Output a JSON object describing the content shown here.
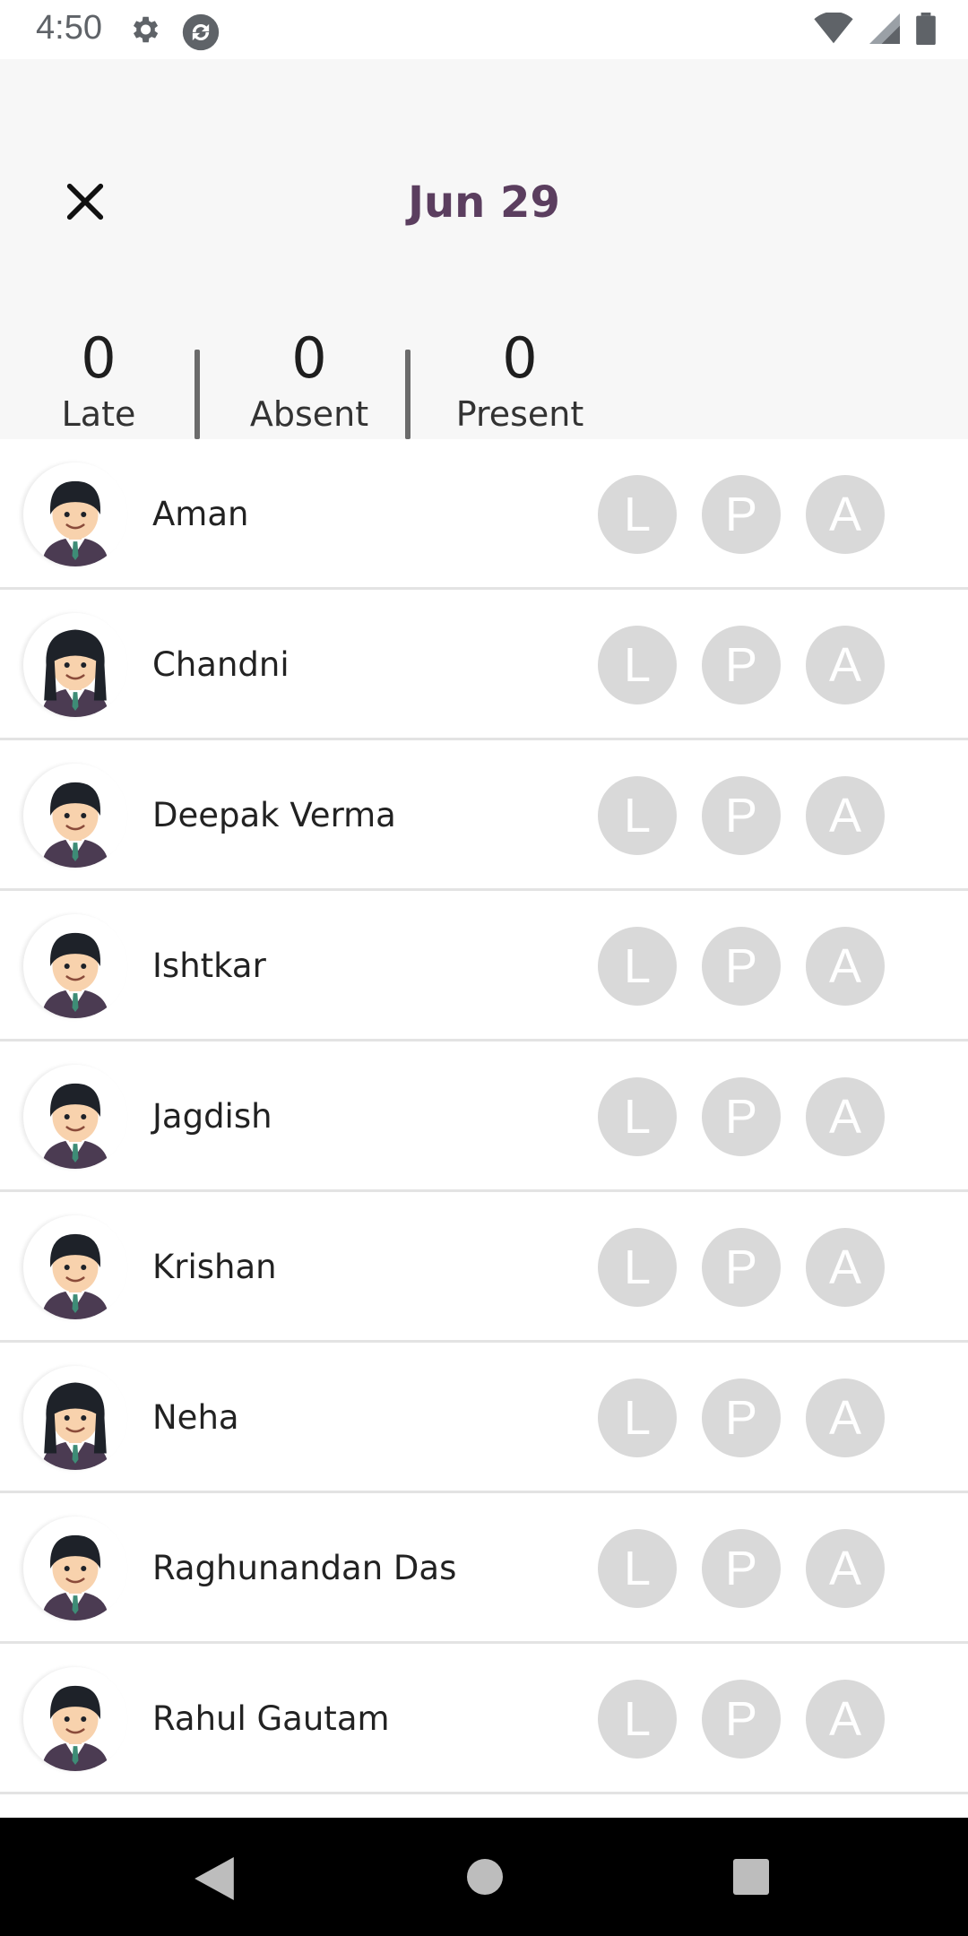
{
  "status_bar": {
    "time": "4:50",
    "left_icons": [
      "gear-icon",
      "sync-icon"
    ],
    "right_icons": [
      "wifi-icon",
      "signal-icon",
      "battery-icon"
    ]
  },
  "header": {
    "close_icon": "close-icon",
    "date": "Jun 29",
    "title_color": "#5b3e5f",
    "stats": [
      {
        "value": "0",
        "label": "Late"
      },
      {
        "value": "0",
        "label": "Absent"
      },
      {
        "value": "0",
        "label": "Present"
      }
    ]
  },
  "students": [
    {
      "name": "Aman",
      "avatar": "boy"
    },
    {
      "name": "Chandni",
      "avatar": "girl"
    },
    {
      "name": "Deepak Verma",
      "avatar": "boy"
    },
    {
      "name": "Ishtkar",
      "avatar": "boy"
    },
    {
      "name": "Jagdish",
      "avatar": "boy"
    },
    {
      "name": "Krishan",
      "avatar": "boy"
    },
    {
      "name": "Neha",
      "avatar": "girl"
    },
    {
      "name": "Raghunandan Das",
      "avatar": "boy"
    },
    {
      "name": "Rahul Gautam",
      "avatar": "boy"
    }
  ],
  "attendance_buttons": {
    "late": "L",
    "present": "P",
    "absent": "A",
    "inactive_color": "#d9d9d9"
  },
  "nav_bar": {
    "icons": [
      "back-icon",
      "home-icon",
      "recents-icon"
    ]
  }
}
